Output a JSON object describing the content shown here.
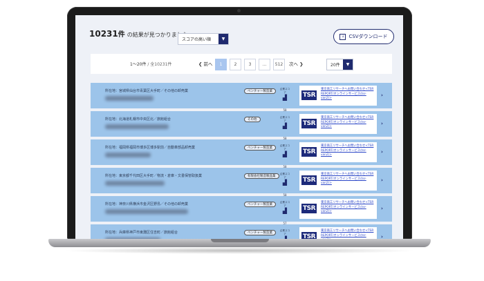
{
  "summary": {
    "count": "10231",
    "unit": "件",
    "suffix": "の結果が見つかりました。"
  },
  "sort": {
    "selected": "スコアの高い順"
  },
  "csv_button": {
    "label": "CSVダウンロード"
  },
  "pager": {
    "range": "1〜20件",
    "total": "全10231件",
    "prev": "前へ",
    "next": "次へ",
    "pages": [
      "1",
      "2",
      "3",
      "…",
      "512"
    ],
    "active_page": "1",
    "per_page": "20件"
  },
  "tsr_card": {
    "logo": "TSR",
    "link_text": "東京商工リサーチへお問い合わせ<TSR REPORT/オンラインサービス(tsr-van2)>"
  },
  "results": [
    {
      "address": "所在地：宮城県仙台市青葉区大手町／その他の卸売業",
      "badge": "ベンチャー製造業",
      "score_label": "企業スコア",
      "score": "58"
    },
    {
      "address": "所在地：北海道札幌市中央区北／旅館組合",
      "badge": "その他",
      "score_label": "企業スコア",
      "score": "58"
    },
    {
      "address": "所在地：福岡県福岡市博多区博多駅前／自動車部品卸売業",
      "badge": "ベンチャー製造業",
      "score_label": "企業スコア",
      "score": "58"
    },
    {
      "address": "所在地：東京都千代田区大手町／物流・倉庫・文書保管取扱業",
      "badge": "有限会社製造製品業",
      "score_label": "企業スコア",
      "score": "58"
    },
    {
      "address": "所在地：神奈川県横浜市金沢区野島／その他の卸売業",
      "badge": "ベンチャー製造業",
      "score_label": "企業スコア",
      "score": "57"
    },
    {
      "address": "所在地：兵庫県神戸市東灘区住吉町／旅館組合",
      "badge": "ベンチャー製造業",
      "score_label": "企業スコア",
      "score": "57"
    }
  ]
}
